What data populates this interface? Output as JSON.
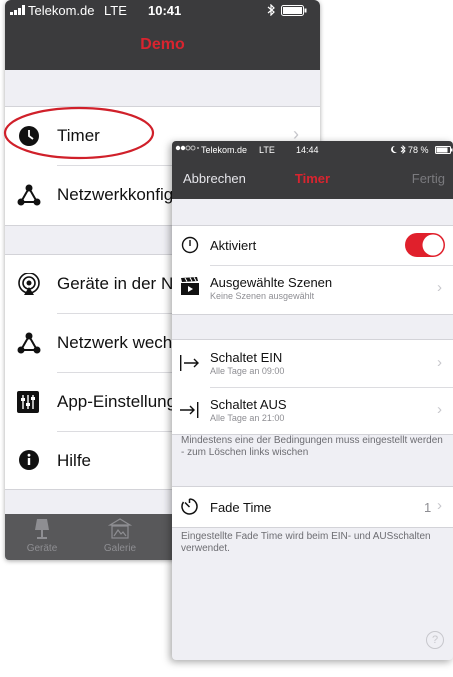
{
  "back_screen": {
    "status": {
      "carrier": "Telekom.de",
      "network": "LTE",
      "time": "10:41"
    },
    "nav_title": "Demo",
    "items": [
      {
        "label": "Timer",
        "icon": "clock-icon"
      },
      {
        "label": "Netzwerkkonfig",
        "icon": "network-icon"
      },
      {
        "label": "Geräte in der N",
        "icon": "broadcast-icon"
      },
      {
        "label": "Netzwerk wech",
        "icon": "network-icon"
      },
      {
        "label": "App-Einstellung",
        "icon": "sliders-icon"
      },
      {
        "label": "Hilfe",
        "icon": "info-icon"
      }
    ],
    "tabs": [
      {
        "label": "Geräte",
        "icon": "lamp-icon"
      },
      {
        "label": "Galerie",
        "icon": "gallery-icon"
      }
    ],
    "highlight_color": "#d0202a"
  },
  "front_screen": {
    "status": {
      "carrier": "Telekom.de",
      "network": "LTE",
      "time": "14:44",
      "battery": "78 %"
    },
    "nav": {
      "left": "Abbrechen",
      "title": "Timer",
      "right": "Fertig"
    },
    "activated": {
      "label": "Aktiviert",
      "on": true
    },
    "scenes": {
      "label": "Ausgewählte Szenen",
      "sub": "Keine Szenen ausgewählt"
    },
    "on_row": {
      "label": "Schaltet EIN",
      "sub": "Alle Tage an  09:00"
    },
    "off_row": {
      "label": "Schaltet AUS",
      "sub": "Alle Tage an  21:00"
    },
    "conditions_note": "Mindestens eine der Bedingungen muss eingestellt werden - zum Löschen links wischen",
    "fade": {
      "label": "Fade Time",
      "value": "1"
    },
    "fade_note": "Eingestellte Fade Time wird beim EIN- und AUSschalten verwendet.",
    "help_icon": "?"
  },
  "colors": {
    "accent": "#d9242f",
    "toggle_on": "#e0202c",
    "bar": "#3b3b3d"
  }
}
